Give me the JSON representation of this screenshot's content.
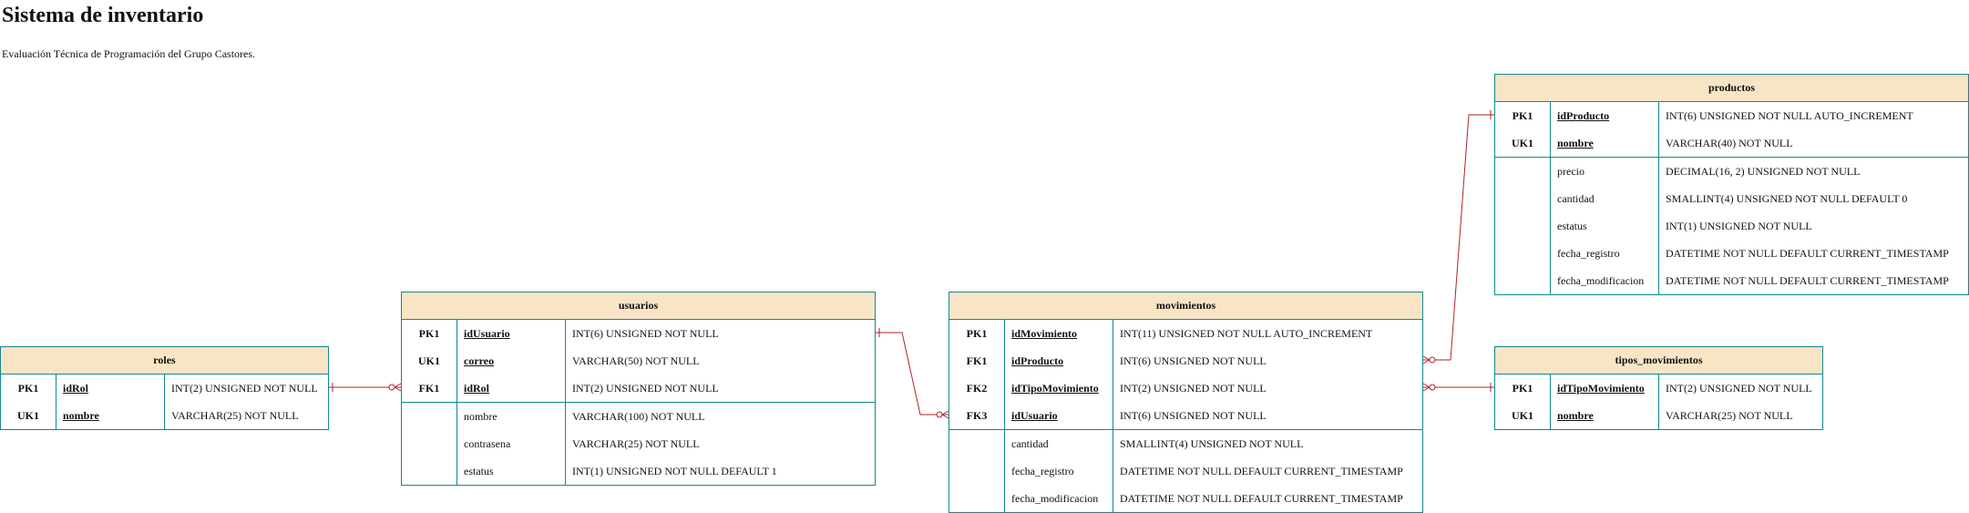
{
  "title": "Sistema de inventario",
  "subtitle": "Evaluación Técnica de Programación del Grupo Castores.",
  "colors": {
    "border": "#12898f",
    "header_bg": "#f9e5c6",
    "relation": "#b22222"
  },
  "tables": {
    "roles": {
      "name": "roles",
      "rows": [
        {
          "key": "PK1",
          "name": "idRol",
          "type": "INT(2) UNSIGNED NOT NULL"
        },
        {
          "key": "UK1",
          "name": "nombre",
          "type": "VARCHAR(25) NOT NULL"
        }
      ]
    },
    "usuarios": {
      "name": "usuarios",
      "rows": [
        {
          "key": "PK1",
          "name": "idUsuario",
          "type": "INT(6) UNSIGNED NOT NULL"
        },
        {
          "key": "UK1",
          "name": "correo",
          "type": "VARCHAR(50) NOT NULL"
        },
        {
          "key": "FK1",
          "name": "idRol",
          "type": "INT(2) UNSIGNED NOT NULL"
        },
        {
          "key": "",
          "name": "nombre",
          "type": "VARCHAR(100) NOT NULL"
        },
        {
          "key": "",
          "name": "contrasena",
          "type": "VARCHAR(25) NOT NULL"
        },
        {
          "key": "",
          "name": "estatus",
          "type": "INT(1) UNSIGNED NOT NULL DEFAULT 1"
        }
      ]
    },
    "movimientos": {
      "name": "movimientos",
      "rows": [
        {
          "key": "PK1",
          "name": "idMovimiento",
          "type": "INT(11) UNSIGNED NOT NULL AUTO_INCREMENT"
        },
        {
          "key": "FK1",
          "name": "idProducto",
          "type": "INT(6) UNSIGNED NOT NULL"
        },
        {
          "key": "FK2",
          "name": "idTipoMovimiento",
          "type": "INT(2) UNSIGNED NOT NULL"
        },
        {
          "key": "FK3",
          "name": "idUsuario",
          "type": "INT(6) UNSIGNED NOT NULL"
        },
        {
          "key": "",
          "name": "cantidad",
          "type": "SMALLINT(4) UNSIGNED NOT NULL"
        },
        {
          "key": "",
          "name": "fecha_registro",
          "type": "DATETIME NOT NULL DEFAULT CURRENT_TIMESTAMP"
        },
        {
          "key": "",
          "name": "fecha_modificacion",
          "type": "DATETIME NOT NULL DEFAULT CURRENT_TIMESTAMP"
        }
      ]
    },
    "productos": {
      "name": "productos",
      "rows": [
        {
          "key": "PK1",
          "name": "idProducto",
          "type": "INT(6) UNSIGNED NOT NULL AUTO_INCREMENT"
        },
        {
          "key": "UK1",
          "name": "nombre",
          "type": "VARCHAR(40) NOT NULL"
        },
        {
          "key": "",
          "name": "precio",
          "type": "DECIMAL(16, 2) UNSIGNED NOT NULL"
        },
        {
          "key": "",
          "name": "cantidad",
          "type": "SMALLINT(4) UNSIGNED NOT NULL DEFAULT 0"
        },
        {
          "key": "",
          "name": "estatus",
          "type": "INT(1) UNSIGNED NOT NULL"
        },
        {
          "key": "",
          "name": "fecha_registro",
          "type": "DATETIME NOT NULL DEFAULT CURRENT_TIMESTAMP"
        },
        {
          "key": "",
          "name": "fecha_modificacion",
          "type": "DATETIME NOT NULL DEFAULT CURRENT_TIMESTAMP"
        }
      ]
    },
    "tipos_movimientos": {
      "name": "tipos_movimientos",
      "rows": [
        {
          "key": "PK1",
          "name": "idTipoMovimiento",
          "type": "INT(2) UNSIGNED NOT NULL"
        },
        {
          "key": "UK1",
          "name": "nombre",
          "type": "VARCHAR(25) NOT NULL"
        }
      ]
    }
  },
  "relationships": [
    {
      "one": "roles",
      "many": "usuarios",
      "type": "one-to-zero-or-many"
    },
    {
      "one": "usuarios",
      "many": "movimientos",
      "type": "one-to-zero-or-many"
    },
    {
      "one": "productos",
      "many": "movimientos",
      "type": "one-to-zero-or-many"
    },
    {
      "one": "tipos_movimientos",
      "many": "movimientos",
      "type": "one-to-zero-or-many"
    }
  ]
}
